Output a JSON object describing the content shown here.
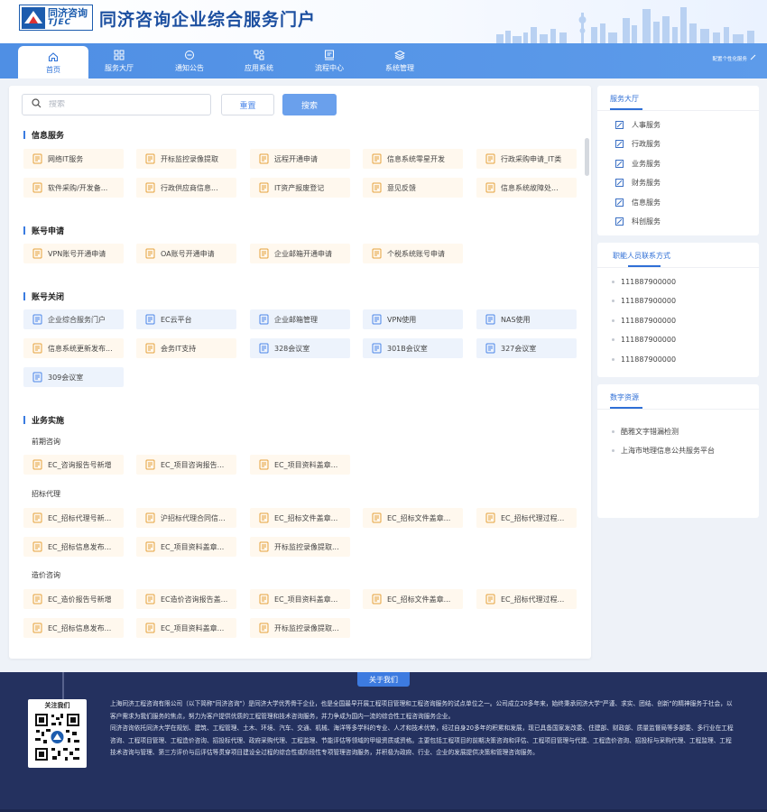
{
  "header": {
    "logo_cn": "同济咨询",
    "logo_en": "TJEC",
    "portal_title": "同济咨询企业综合服务门户"
  },
  "nav": {
    "items": [
      {
        "label": "首页",
        "icon": "home-icon"
      },
      {
        "label": "服务大厅",
        "icon": "grid-icon"
      },
      {
        "label": "通知公告",
        "icon": "notice-icon"
      },
      {
        "label": "应用系统",
        "icon": "apps-icon"
      },
      {
        "label": "流程中心",
        "icon": "process-icon"
      },
      {
        "label": "系统管理",
        "icon": "layers-icon"
      }
    ],
    "personal": "配置个性化服务"
  },
  "search": {
    "placeholder": "搜索",
    "value": "",
    "reset_label": "重置",
    "search_label": "搜索"
  },
  "sections": {
    "info": {
      "title": "信息服务",
      "cards": [
        "网络IT服务",
        "开标监控录像提取",
        "远程开通申请",
        "信息系统零星开发",
        "行政采购申请_IT类",
        "软件采购/开发备...",
        "行政供应商信息...",
        "IT资产报废登记",
        "意见反馈",
        "信息系统故障处..."
      ]
    },
    "account_apply": {
      "title": "账号申请",
      "cards": [
        "VPN账号开通申请",
        "OA账号开通申请",
        "企业邮箱开通申请",
        "个税系统账号申请"
      ]
    },
    "account_close": {
      "title": "账号关闭",
      "cards": [
        "企业综合服务门户",
        "EC云平台",
        "企业邮箱管理",
        "VPN使用",
        "NAS使用",
        "信息系统更新发布...",
        "会务IT支持",
        "328会议室",
        "301B会议室",
        "327会议室",
        "309会议室"
      ]
    },
    "business": {
      "title": "业务实施",
      "sub1": "前期咨询",
      "sub1_cards": [
        "EC_咨询报告号新增",
        "EC_项目咨询报告...",
        "EC_项目资料盖章..."
      ],
      "sub2": "招标代理",
      "sub2_cards": [
        "EC_招标代理号新...",
        "沪招标代理合同信...",
        "EC_招标文件盖章...",
        "EC_招标文件盖章...",
        "EC_招标代理过程...",
        "EC_招标信息发布...",
        "EC_项目资料盖章...",
        "开标监控录像提取..."
      ],
      "sub3": "造价咨询",
      "sub3_cards": [
        "EC_造价报告号新增",
        "EC造价咨询报告盖...",
        "EC_项目资料盖章...",
        "EC_招标文件盖章...",
        "EC_招标代理过程...",
        "EC_招标信息发布...",
        "EC_项目资料盖章...",
        "开标监控录像提取..."
      ]
    }
  },
  "right": {
    "hall_title": "服务大厅",
    "hall_items": [
      "人事服务",
      "行政服务",
      "业务服务",
      "财务服务",
      "信息服务",
      "科创服务"
    ],
    "contact_title": "职能人员联系方式",
    "contacts": [
      "111887900000",
      "111887900000",
      "111887900000",
      "111887900000",
      "111887900000"
    ],
    "digital_title": "数字资源",
    "digital_items": [
      "酷雅文字错漏检测",
      "上海市地理信息公共服务平台"
    ]
  },
  "footer": {
    "about": "关于我们",
    "follow": "关注我们",
    "para1": "上海同济工程咨询有限公司（以下简称\"同济咨询\"）是同济大学优秀骨干企业，也是全国最早开展工程项目管理和工程咨询服务的试点单位之一。公司成立20多年来，始终秉承同济大学\"严谨、求实、团结、创新\"的精神服务于社会，以客户需求为我们服务的焦点，努力为客户提供优质的工程管理和技术咨询服务，并力争成为国内一流的综合性工程咨询服务企业。",
    "para2": "同济咨询依托同济大学在规划、建筑、工程管理、土木、环境、汽车、交通、机械、海洋等多学科的专业、人才和技术优势，经过自身20多年的积累和发展，现已具备国家发改委、住建部、财政部、质量监督局等多部委、多行业在工程咨询、工程项目管理、工程造价咨询、招投标代理、政府采购代理、工程监理、节能评估等领域的甲级资质或资格。主要包括工程项目的前期决策咨询和评估、工程项目管理与代建、工程造价咨询、招投标与采购代理、工程监理、工程技术咨询与管理、第三方评价与后评估等贯穿项目建设全过程的综合性或阶段性专项管理咨询服务，并积极为政府、行业、企业的发展提供决策和管理咨询服务。"
  },
  "colors": {
    "accent": "#3a7be0",
    "nav": "#5590e6",
    "footer": "#24315f"
  }
}
